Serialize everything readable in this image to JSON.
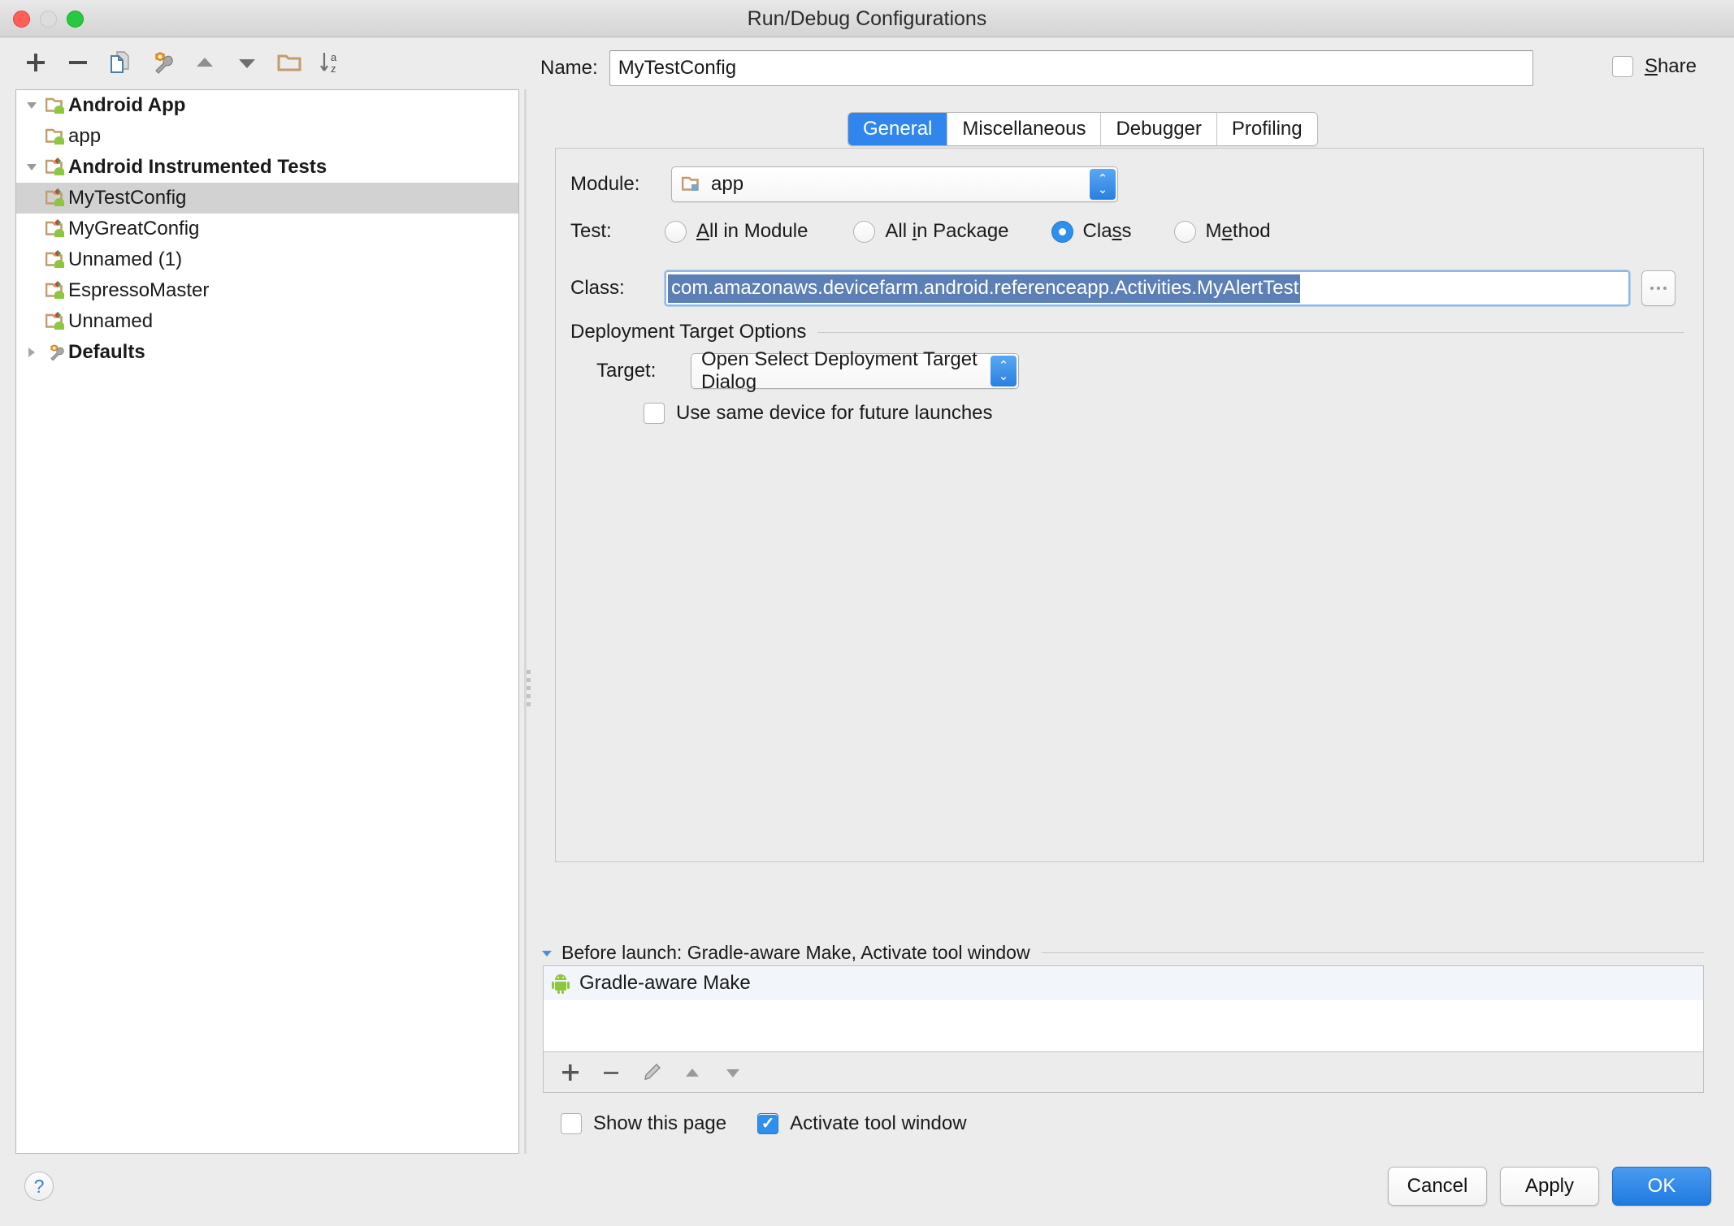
{
  "window": {
    "title": "Run/Debug Configurations",
    "traffic_lights": [
      "close",
      "minimize",
      "zoom"
    ]
  },
  "toolbar": {
    "buttons": [
      {
        "name": "add",
        "icon": "plus-icon"
      },
      {
        "name": "remove",
        "icon": "minus-icon"
      },
      {
        "name": "copy",
        "icon": "copy-icon"
      },
      {
        "name": "edit-defaults",
        "icon": "wrench-icon"
      },
      {
        "name": "move-up",
        "icon": "arrow-up-icon"
      },
      {
        "name": "move-down",
        "icon": "arrow-down-icon"
      },
      {
        "name": "create-folder",
        "icon": "folder-icon"
      },
      {
        "name": "sort-alphabetically",
        "icon": "sort-az-icon"
      }
    ]
  },
  "tree": {
    "items": [
      {
        "label": "Android App",
        "level": 0,
        "bold": true,
        "twisty": "down",
        "icon": "android-folder-icon",
        "selected": false
      },
      {
        "label": "app",
        "level": 1,
        "bold": false,
        "twisty": "none",
        "icon": "android-folder-icon",
        "selected": false
      },
      {
        "label": "Android Instrumented Tests",
        "level": 0,
        "bold": true,
        "twisty": "down",
        "icon": "android-test-folder-icon",
        "selected": false
      },
      {
        "label": "MyTestConfig",
        "level": 1,
        "bold": false,
        "twisty": "none",
        "icon": "android-test-icon",
        "selected": true
      },
      {
        "label": "MyGreatConfig",
        "level": 1,
        "bold": false,
        "twisty": "none",
        "icon": "android-test-icon",
        "selected": false
      },
      {
        "label": "Unnamed (1)",
        "level": 1,
        "bold": false,
        "twisty": "none",
        "icon": "android-test-icon",
        "selected": false
      },
      {
        "label": "EspressoMaster",
        "level": 1,
        "bold": false,
        "twisty": "none",
        "icon": "android-test-icon",
        "selected": false
      },
      {
        "label": "Unnamed",
        "level": 1,
        "bold": false,
        "twisty": "none",
        "icon": "android-test-icon",
        "selected": false
      },
      {
        "label": "Defaults",
        "level": 0,
        "bold": true,
        "twisty": "right",
        "icon": "wrench-icon",
        "selected": false
      }
    ]
  },
  "name_field": {
    "label": "Name:",
    "value": "MyTestConfig",
    "placeholder": ""
  },
  "share": {
    "label_pre": "",
    "mnemonic": "S",
    "label_post": "hare",
    "checked": false
  },
  "tabs": [
    {
      "label": "General",
      "active": true
    },
    {
      "label": "Miscellaneous",
      "active": false
    },
    {
      "label": "Debugger",
      "active": false
    },
    {
      "label": "Profiling",
      "active": false
    }
  ],
  "general": {
    "module": {
      "label": "Module:",
      "value": "app",
      "icon": "module-folder-icon"
    },
    "test": {
      "label": "Test:",
      "options": [
        {
          "pre": "",
          "mnemonic": "A",
          "post": "ll in Module",
          "selected": false
        },
        {
          "pre": "All ",
          "mnemonic": "i",
          "post": "n Package",
          "selected": false
        },
        {
          "pre": "Cla",
          "mnemonic": "s",
          "post": "s",
          "selected": true
        },
        {
          "pre": "M",
          "mnemonic": "e",
          "post": "thod",
          "selected": false
        }
      ]
    },
    "class": {
      "label": "Class:",
      "value": "com.amazonaws.devicefarm.android.referenceapp.Activities.MyAlertTest",
      "selected": true,
      "browse_button": "..."
    },
    "deployment": {
      "group_title": "Deployment Target Options",
      "target": {
        "label": "Target:",
        "value": "Open Select Deployment Target Dialog"
      },
      "use_same_device": {
        "label": "Use same device for future launches",
        "checked": false
      }
    }
  },
  "before_launch": {
    "header": "Before launch: Gradle-aware Make, Activate tool window",
    "expanded": true,
    "items": [
      {
        "label": "Gradle-aware Make",
        "icon": "android-robot-icon",
        "selected": true
      }
    ],
    "toolbar": [
      {
        "name": "add-task",
        "icon": "plus-icon"
      },
      {
        "name": "remove-task",
        "icon": "minus-icon"
      },
      {
        "name": "edit-task",
        "icon": "pencil-icon"
      },
      {
        "name": "move-task-up",
        "icon": "arrow-up-icon"
      },
      {
        "name": "move-task-down",
        "icon": "arrow-down-icon"
      }
    ],
    "show_this_page": {
      "label": "Show this page",
      "checked": false
    },
    "activate_tool_window": {
      "label": "Activate tool window",
      "checked": true
    }
  },
  "footer": {
    "help": "?",
    "cancel": "Cancel",
    "apply": "Apply",
    "ok": "OK"
  },
  "colors": {
    "accent_blue": "#2f8fec",
    "tab_active": "#3086ec",
    "selection_blue": "#5c7fb5",
    "tree_selected": "#d2d2d2",
    "background": "#ececec",
    "android_green": "#8dc63f",
    "folder_tan": "#c49a6c"
  }
}
